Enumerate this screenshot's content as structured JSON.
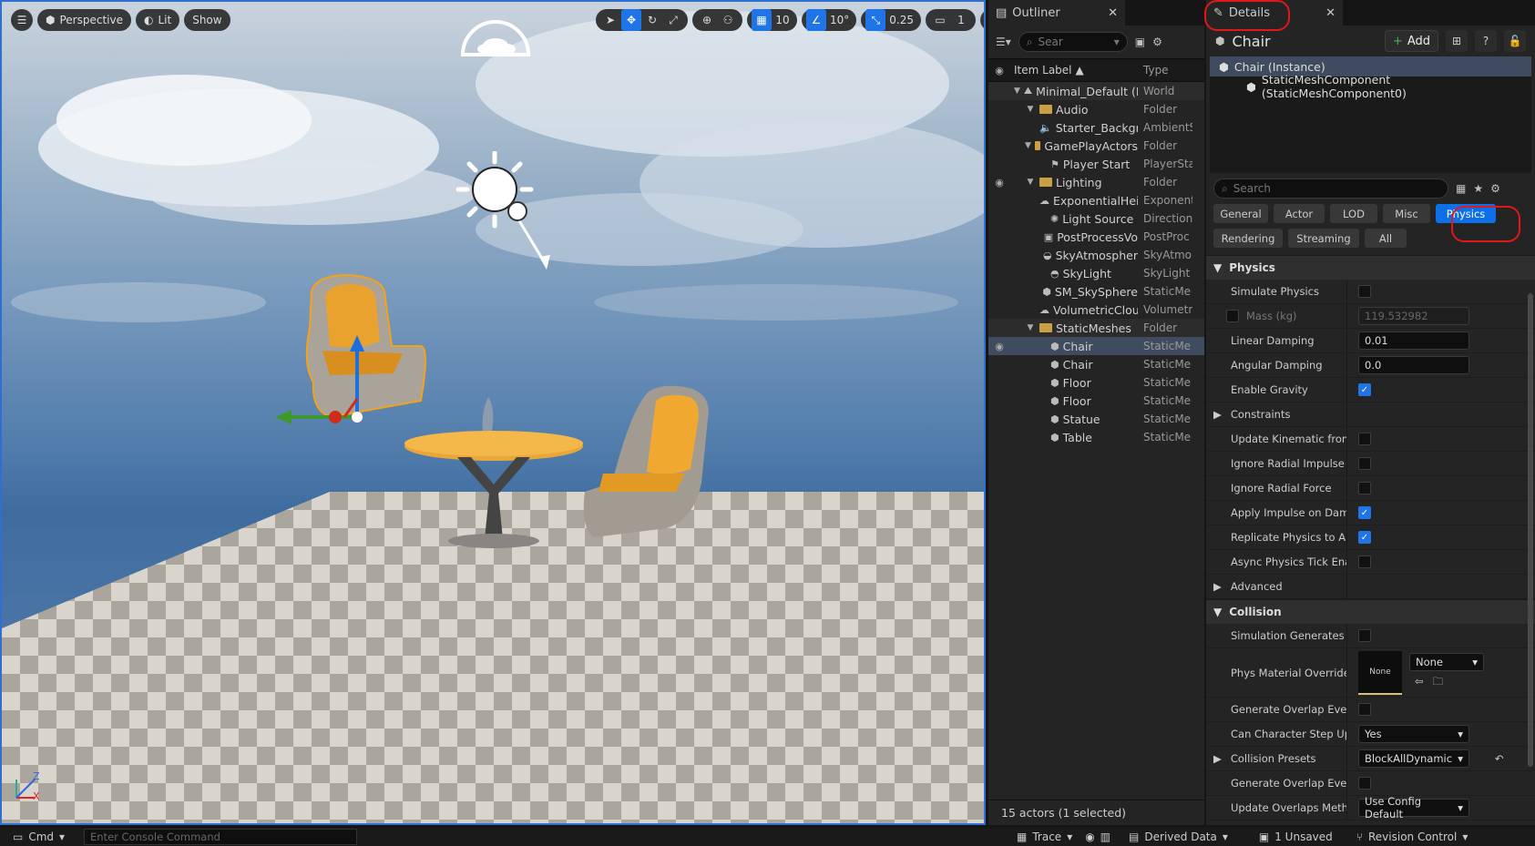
{
  "viewport": {
    "menu_icon": "hamburger-icon",
    "perspective_label": "Perspective",
    "lit_label": "Lit",
    "show_label": "Show",
    "grid_snap_value": "10",
    "rotation_snap_value": "10°",
    "scale_snap_value": "0.25",
    "camera_speed_value": "1",
    "axis_z": "Z",
    "axis_x": "X"
  },
  "outliner": {
    "tab_label": "Outliner",
    "search_placeholder": "Sear",
    "col_label": "Item Label",
    "col_type": "Type",
    "rows": [
      {
        "label": "Minimal_Default (Ed",
        "type": "World"
      },
      {
        "label": "Audio",
        "type": "Folder"
      },
      {
        "label": "Starter_Backgr",
        "type": "AmbientS"
      },
      {
        "label": "GamePlayActors",
        "type": "Folder"
      },
      {
        "label": "Player Start",
        "type": "PlayerSta"
      },
      {
        "label": "Lighting",
        "type": "Folder"
      },
      {
        "label": "ExponentialHei",
        "type": "Exponent"
      },
      {
        "label": "Light Source",
        "type": "Direction"
      },
      {
        "label": "PostProcessVo",
        "type": "PostProc"
      },
      {
        "label": "SkyAtmospher",
        "type": "SkyAtmo"
      },
      {
        "label": "SkyLight",
        "type": "SkyLight"
      },
      {
        "label": "SM_SkySphere",
        "type": "StaticMe"
      },
      {
        "label": "VolumetricClou",
        "type": "Volumetr"
      },
      {
        "label": "StaticMeshes",
        "type": "Folder"
      },
      {
        "label": "Chair",
        "type": "StaticMe"
      },
      {
        "label": "Chair",
        "type": "StaticMe"
      },
      {
        "label": "Floor",
        "type": "StaticMe"
      },
      {
        "label": "Floor",
        "type": "StaticMe"
      },
      {
        "label": "Statue",
        "type": "StaticMe"
      },
      {
        "label": "Table",
        "type": "StaticMe"
      }
    ],
    "footer": "15 actors (1 selected)"
  },
  "details": {
    "tab_label": "Details",
    "title": "Chair",
    "add_label": "Add",
    "components": [
      "Chair (Instance)",
      "StaticMeshComponent (StaticMeshComponent0)"
    ],
    "search_placeholder": "Search",
    "filters": [
      "General",
      "Actor",
      "LOD",
      "Misc",
      "Physics",
      "Rendering",
      "Streaming",
      "All"
    ],
    "physics_section": "Physics",
    "simulate_physics": "Simulate Physics",
    "mass_label": "Mass (kg)",
    "mass_value": "119.532982",
    "linear_damping_label": "Linear Damping",
    "linear_damping_value": "0.01",
    "angular_damping_label": "Angular Damping",
    "angular_damping_value": "0.0",
    "enable_gravity_label": "Enable Gravity",
    "constraints_label": "Constraints",
    "update_kinematic_label": "Update Kinematic from...",
    "ignore_radial_impulse_label": "Ignore Radial Impulse",
    "ignore_radial_force_label": "Ignore Radial Force",
    "apply_impulse_label": "Apply Impulse on Damage",
    "replicate_physics_label": "Replicate Physics to Aut...",
    "async_physics_label": "Async Physics Tick Ena...",
    "advanced_label": "Advanced",
    "collision_section": "Collision",
    "sim_gen_hit_label": "Simulation Generates Hi...",
    "phys_material_label": "Phys Material Override",
    "phys_material_thumb": "None",
    "phys_material_value": "None",
    "gen_overlap_label": "Generate Overlap Events",
    "can_step_label": "Can Character Step Up On",
    "can_step_value": "Yes",
    "collision_presets_label": "Collision Presets",
    "collision_presets_value": "BlockAllDynamic",
    "gen_overlap2_label": "Generate Overlap Event...",
    "update_overlaps_label": "Update Overlaps Metho...",
    "update_overlaps_value": "Use Config Default"
  },
  "statusbar": {
    "cmd_label": "Cmd",
    "console_placeholder": "Enter Console Command",
    "trace_label": "Trace",
    "derived_data_label": "Derived Data",
    "unsaved_label": "1 Unsaved",
    "revision_label": "Revision Control"
  }
}
